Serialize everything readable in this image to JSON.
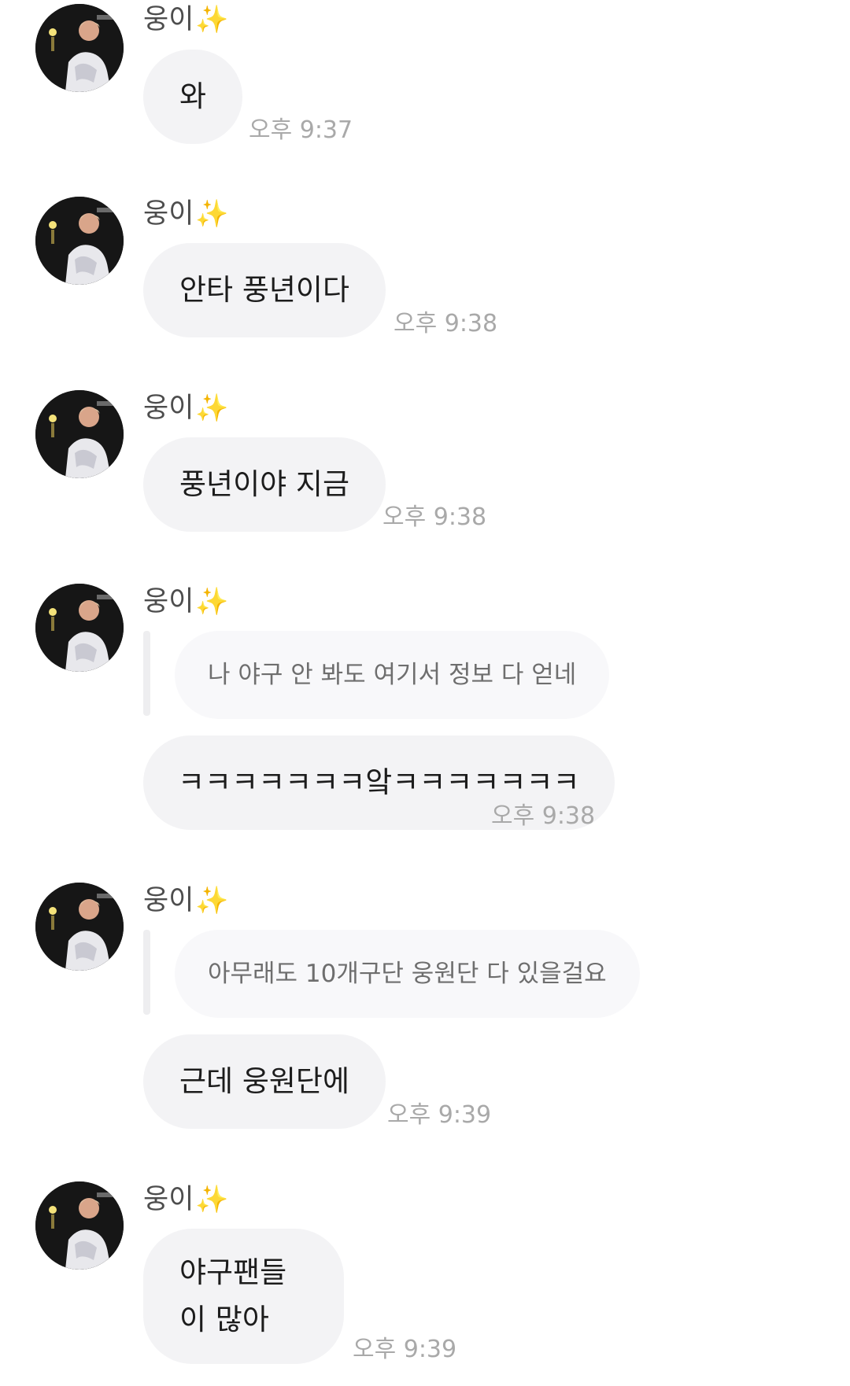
{
  "sender": {
    "name": "웅이",
    "badge": "✨",
    "avatar": "avatar-photo"
  },
  "messages": [
    {
      "text": "와",
      "time": "오후 9:37"
    },
    {
      "text": "안타 풍년이다",
      "time": "오후 9:38"
    },
    {
      "text": "풍년이야 지금",
      "time": "오후 9:38"
    },
    {
      "quote": "나 야구 안 봐도 여기서 정보 다 얻네",
      "text": "ㅋㅋㅋㅋㅋㅋㅋ앜ㅋㅋㅋㅋㅋㅋㅋ",
      "time": "오후 9:38"
    },
    {
      "quote": "아무래도 10개구단 웅원단 다 있을걸요",
      "text": "근데 웅원단에",
      "time": "오후 9:39"
    },
    {
      "text": "야구팬들이 많아",
      "time": "오후 9:39"
    }
  ],
  "colors": {
    "bubble": "#f3f3f5",
    "quote_bubble": "#f8f8fa",
    "time": "#a9a9a9",
    "sparkle": "#f2c230"
  }
}
